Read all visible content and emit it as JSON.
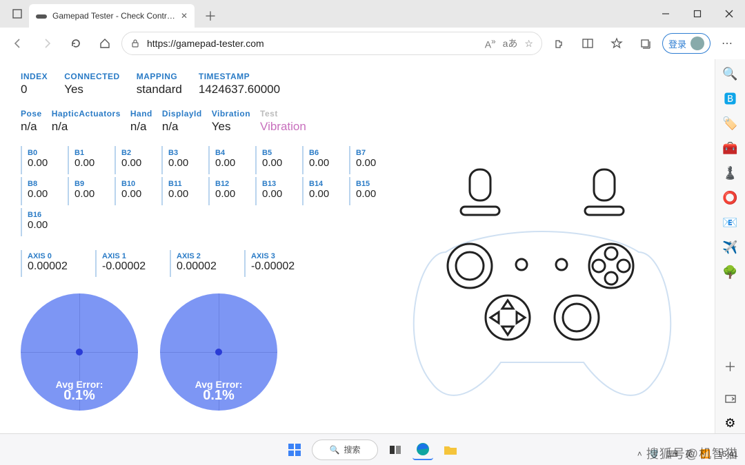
{
  "browser": {
    "tab_title": "Gamepad Tester - Check Controll…",
    "url_display": "https://gamepad-tester.com",
    "login_label": "登录"
  },
  "meta1": [
    {
      "label": "INDEX",
      "value": "0"
    },
    {
      "label": "CONNECTED",
      "value": "Yes"
    },
    {
      "label": "MAPPING",
      "value": "standard"
    },
    {
      "label": "TIMESTAMP",
      "value": "1424637.60000"
    }
  ],
  "meta2": [
    {
      "label": "Pose",
      "value": "n/a"
    },
    {
      "label": "HapticActuators",
      "value": "n/a"
    },
    {
      "label": "Hand",
      "value": "n/a"
    },
    {
      "label": "DisplayId",
      "value": "n/a"
    },
    {
      "label": "Vibration",
      "value": "Yes"
    },
    {
      "label": "Test",
      "value": "Vibration",
      "faded": true,
      "vib": true
    }
  ],
  "buttons": [
    {
      "label": "B0",
      "value": "0.00"
    },
    {
      "label": "B1",
      "value": "0.00"
    },
    {
      "label": "B2",
      "value": "0.00"
    },
    {
      "label": "B3",
      "value": "0.00"
    },
    {
      "label": "B4",
      "value": "0.00"
    },
    {
      "label": "B5",
      "value": "0.00"
    },
    {
      "label": "B6",
      "value": "0.00"
    },
    {
      "label": "B7",
      "value": "0.00"
    },
    {
      "label": "B8",
      "value": "0.00"
    },
    {
      "label": "B9",
      "value": "0.00"
    },
    {
      "label": "B10",
      "value": "0.00"
    },
    {
      "label": "B11",
      "value": "0.00"
    },
    {
      "label": "B12",
      "value": "0.00"
    },
    {
      "label": "B13",
      "value": "0.00"
    },
    {
      "label": "B14",
      "value": "0.00"
    },
    {
      "label": "B15",
      "value": "0.00"
    },
    {
      "label": "B16",
      "value": "0.00"
    }
  ],
  "axes": [
    {
      "label": "AXIS 0",
      "value": "0.00002"
    },
    {
      "label": "AXIS 1",
      "value": "-0.00002"
    },
    {
      "label": "AXIS 2",
      "value": "0.00002"
    },
    {
      "label": "AXIS 3",
      "value": "-0.00002"
    }
  ],
  "sticks": [
    {
      "title": "Avg Error:",
      "pct": "0.1%"
    },
    {
      "title": "Avg Error:",
      "pct": "0.1%"
    }
  ],
  "taskbar": {
    "search": "搜索"
  },
  "tray": {
    "ime": "英",
    "time": "16:41"
  },
  "watermark": "搜狐号@机智猫"
}
